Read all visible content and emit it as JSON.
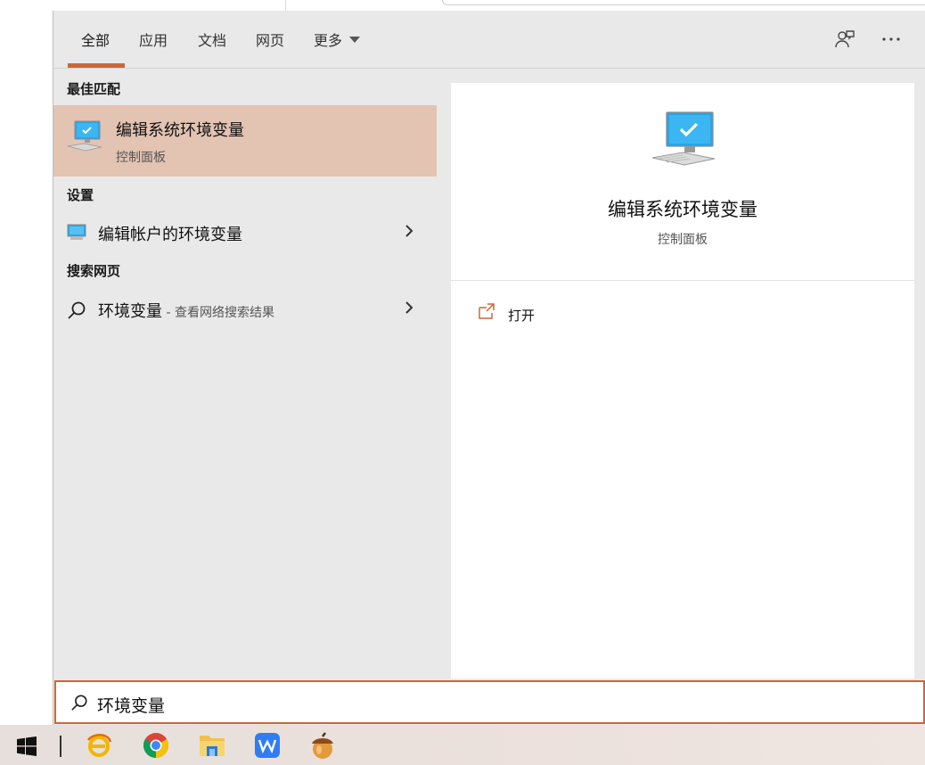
{
  "tabs": [
    {
      "label": "全部",
      "active": true
    },
    {
      "label": "应用"
    },
    {
      "label": "文档"
    },
    {
      "label": "网页"
    },
    {
      "label": "更多"
    }
  ],
  "header_icons": {
    "feedback": "feedback-icon",
    "more": "more-options-icon"
  },
  "sections": {
    "best_match": "最佳匹配",
    "settings": "设置",
    "web": "搜索网页"
  },
  "best_match": {
    "title": "编辑系统环境变量",
    "subtitle": "控制面板",
    "icon": "computer-monitor-icon"
  },
  "settings_item": {
    "label": "编辑帐户的环境变量",
    "icon": "monitor-settings-icon"
  },
  "web_item": {
    "label": "环境变量",
    "suffix": " - 查看网络搜索结果",
    "icon": "search-icon"
  },
  "detail": {
    "title": "编辑系统环境变量",
    "subtitle": "控制面板",
    "open_label": "打开"
  },
  "search": {
    "query": "环境变量"
  },
  "taskbar": {
    "items": [
      "windows-start-icon",
      "browser-e-icon",
      "chrome-icon",
      "file-explorer-icon",
      "wps-icon",
      "acorn-app-icon"
    ]
  },
  "colors": {
    "accent": "#c8683a",
    "highlight": "#e3c3b1",
    "panel": "#e9e9e9"
  }
}
